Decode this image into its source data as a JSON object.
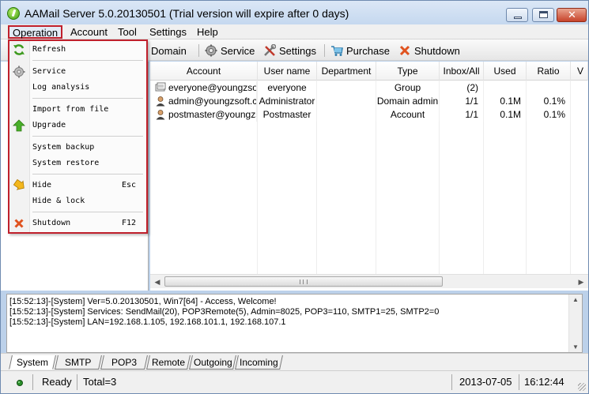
{
  "window": {
    "title": "AAMail Server 5.0.20130501 (Trial version will expire after 0 days)",
    "close_glyph": "✕"
  },
  "menubar": {
    "items": [
      {
        "label": "Operation"
      },
      {
        "label": "Account"
      },
      {
        "label": "Tool"
      },
      {
        "label": "Settings"
      },
      {
        "label": "Help"
      }
    ]
  },
  "toolbar": {
    "domain": "Domain",
    "service": "Service",
    "settings": "Settings",
    "purchase": "Purchase",
    "shutdown": "Shutdown"
  },
  "dropdown": {
    "items": [
      {
        "label": "Refresh",
        "icon": "refresh-icon"
      },
      {
        "label": "Service",
        "icon": "gear-icon"
      },
      {
        "label": "Log analysis"
      },
      {
        "label": "Import from file"
      },
      {
        "label": "Upgrade",
        "icon": "up-arrow-icon"
      },
      {
        "label": "System backup"
      },
      {
        "label": "System restore"
      },
      {
        "label": "Hide",
        "shortcut": "Esc",
        "icon": "hide-arrow-icon"
      },
      {
        "label": "Hide & lock"
      },
      {
        "label": "Shutdown",
        "shortcut": "F12",
        "icon": "close-x-icon"
      }
    ]
  },
  "grid": {
    "columns": [
      "Account",
      "User name",
      "Department",
      "Type",
      "Inbox/All",
      "Used",
      "Ratio",
      "V"
    ],
    "rows": [
      {
        "account": "everyone@youngzso...",
        "username": "everyone",
        "department": "",
        "type": "Group",
        "inbox": "(2)",
        "used": "",
        "ratio": "",
        "icon": "group-icon"
      },
      {
        "account": "admin@youngzsoft.c...",
        "username": "Administrator",
        "department": "",
        "type": "Domain admin",
        "inbox": "1/1",
        "used": "0.1M",
        "ratio": "0.1%",
        "icon": "user-icon"
      },
      {
        "account": "postmaster@youngzs...",
        "username": "Postmaster",
        "department": "",
        "type": "Account",
        "inbox": "1/1",
        "used": "0.1M",
        "ratio": "0.1%",
        "icon": "user-icon"
      }
    ]
  },
  "scroll": {
    "left": "◀",
    "right": "▶",
    "up": "▲",
    "down": "▼"
  },
  "log": {
    "lines": [
      "[15:52:13]-[System] Ver=5.0.20130501, Win7[64] - Access, Welcome!",
      "[15:52:13]-[System] Services: SendMail(20), POP3Remote(5), Admin=8025, POP3=110, SMTP1=25, SMTP2=0",
      "[15:52:13]-[System] LAN=192.168.1.105, 192.168.101.1, 192.168.107.1"
    ]
  },
  "tabs": [
    "System",
    "SMTP",
    "POP3",
    "Remote",
    "Outgoing",
    "Incoming"
  ],
  "status": {
    "ready": "Ready",
    "total": "Total=3",
    "date": "2013-07-05",
    "time": "16:12:44"
  },
  "colors": {
    "highlight_border": "#c0202c",
    "title_bar": "#c5d8ef",
    "close_button": "#c7432a"
  }
}
